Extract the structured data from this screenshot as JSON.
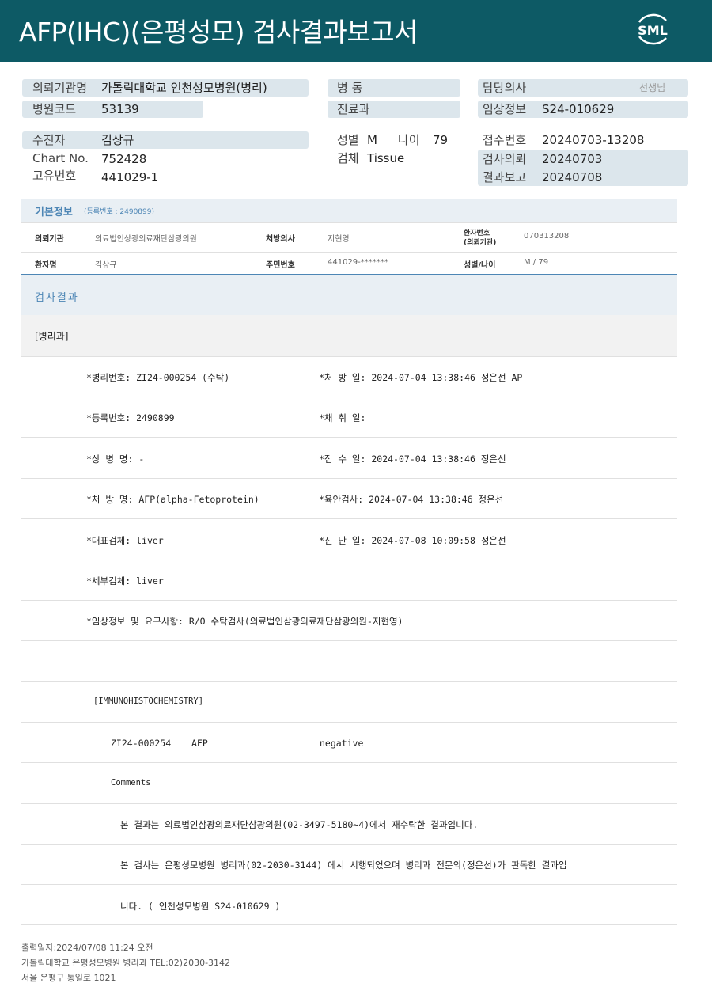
{
  "header": {
    "title": "AFP(IHC)(은평성모) 검사결과보고서",
    "logo_text": "SML"
  },
  "info": {
    "hospital_label": "의뢰기관명",
    "hospital_value": "가톨릭대학교 인천성모병원(병리)",
    "code_label": "병원코드",
    "code_value": "53139",
    "ward_label": "병 동",
    "dept_label": "진료과",
    "doctor_label": "담당의사",
    "doctor_suffix": "선생님",
    "clinical_label": "임상정보",
    "clinical_value": "S24-010629",
    "patient_label": "수진자",
    "patient_value": "김상규",
    "chart_label": "Chart No.",
    "chart_value": "752428",
    "uid_label": "고유번호",
    "uid_value": "441029-1",
    "sex_label": "성별",
    "sex_value": "M",
    "age_label": "나이",
    "age_value": "79",
    "specimen_label": "검체",
    "specimen_value": "Tissue",
    "receipt_label": "접수번호",
    "receipt_value": "20240703-13208",
    "request_label": "검사의뢰",
    "request_value": "20240703",
    "report_label": "결과보고",
    "report_value": "20240708"
  },
  "basic": {
    "title": "기본정보",
    "subtitle": "(등록번호 : 2490899)",
    "inst_label": "의뢰기관",
    "inst_value": "의료법인상광의료재단삼광의원",
    "presc_label": "처방의사",
    "presc_value": "지현영",
    "pno_label_1": "환자번호",
    "pno_label_2": "(의뢰기관)",
    "pno_value": "070313208",
    "name_label": "환자명",
    "name_value": "김상규",
    "rrn_label": "주민번호",
    "rrn_value": "441029-*******",
    "sexage_label": "성별/나이",
    "sexage_value": "M / 79"
  },
  "results": {
    "title": "검사결과",
    "department": "[병리과]",
    "rows": [
      [
        "*병리번호: ZI24-000254 (수탁)",
        "*처 방 일: 2024-07-04 13:38:46  정은선 AP"
      ],
      [
        "*등록번호: 2490899",
        "*채 취 일:"
      ],
      [
        "*상 병 명: -",
        "*접 수 일: 2024-07-04 13:38:46  정은선"
      ],
      [
        "*처 방 명: AFP(alpha-Fetoprotein)",
        "*육안검사: 2024-07-04 13:38:46  정은선"
      ],
      [
        "*대표검체: liver",
        "*진 단 일: 2024-07-08 10:09:58  정은선"
      ],
      [
        "*세부검체: liver",
        ""
      ]
    ],
    "clinical_request": "*임상정보 및 요구사항: R/O 수탁검사(의료법인삼광의료재단삼광의원-지현영)",
    "ihc_header": "[IMMUNOHISTOCHEMISTRY]",
    "ihc_id": "ZI24-000254",
    "ihc_marker": "AFP",
    "ihc_result": "negative",
    "comments_label": "Comments",
    "comment_1": "본 결과는 의료법인삼광의료재단삼광의원(02-3497-5180~4)에서 재수탁한 결과입니다.",
    "comment_2": "본 검사는 은평성모병원 병리과(02-2030-3144) 에서 시행되었으며 병리과 전문의(정은선)가 판독한 결과입",
    "comment_3": "니다. ( 인천성모병원 S24-010629 )"
  },
  "footer": {
    "printed": "출력일자:2024/07/08 11:24 오전",
    "dept": "가톨릭대학교 은평성모병원 병리과 TEL:02)2030-3142",
    "address": "서울 은평구 통일로 1021"
  },
  "colors": {
    "header_bg": "#0d5a65",
    "accent": "#4d86b5",
    "pill_bg": "#dce6ec"
  }
}
